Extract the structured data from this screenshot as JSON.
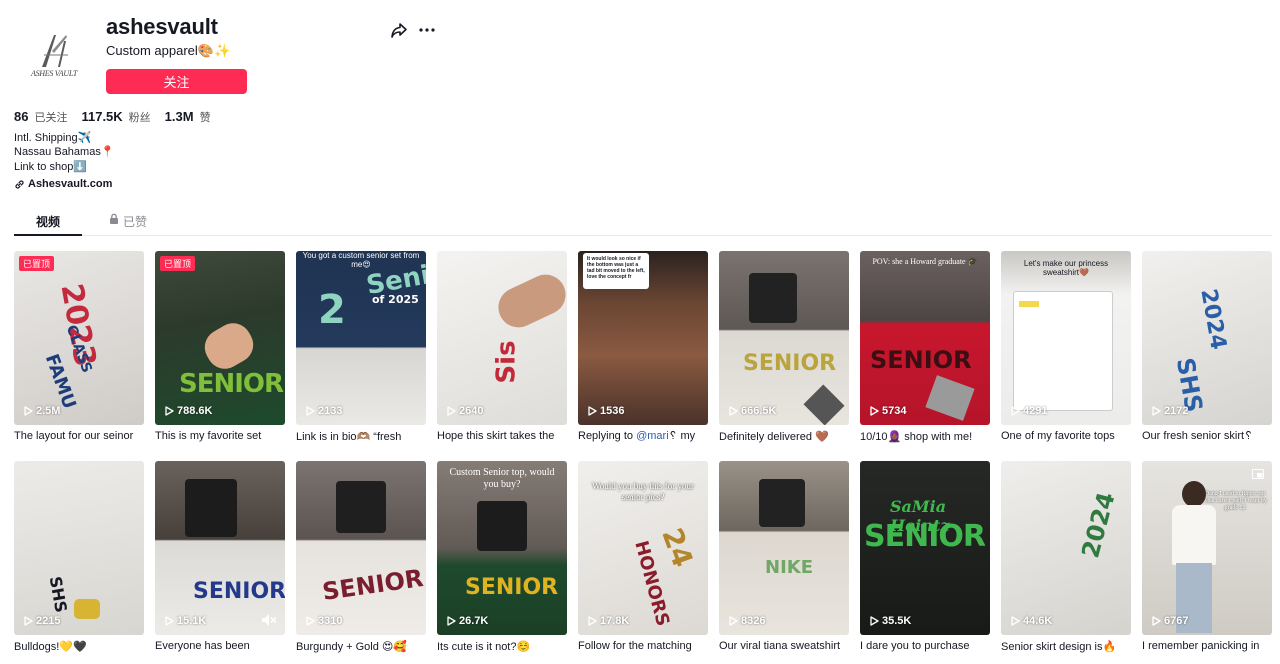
{
  "profile": {
    "username": "ashesvault",
    "nickname": "Custom apparel🎨✨",
    "follow_label": "关注",
    "logo_text": "ASHES VAULT",
    "stats": [
      {
        "value": "86",
        "label": "已关注"
      },
      {
        "value": "117.5K",
        "label": "粉丝"
      },
      {
        "value": "1.3M",
        "label": "赞"
      }
    ],
    "bio": [
      "Intl. Shipping✈️",
      "Nassau Bahamas📍",
      "Link to shop⬇️"
    ],
    "link": "Ashesvault.com"
  },
  "tabs": [
    {
      "label": "视频"
    },
    {
      "label": "已赞"
    }
  ],
  "colors": {
    "accent": "#fe2c55",
    "text": "#161823",
    "muted": "#8a8b91"
  },
  "videos": [
    {
      "views": "2.5M",
      "caption": "The layout for our seinor",
      "pinned": "已置顶"
    },
    {
      "views": "788.6K",
      "caption": "This is my favorite set",
      "pinned": "已置顶"
    },
    {
      "views": "2133",
      "caption": "Link is in bio🫶🏽 “fresh",
      "overlay": "You got a custom senior set from me😍"
    },
    {
      "views": "2640",
      "caption": "Hope this skirt takes the"
    },
    {
      "views": "1536",
      "caption_pre": "Replying to ",
      "mention": "@mari",
      "caption_post": "␦ my",
      "overlay": "It would look so nice if the bottom was just a tad bit moved to the left, love the concept fr"
    },
    {
      "views": "666.5K",
      "caption": "Definitely delivered 🤎"
    },
    {
      "views": "5734",
      "caption": "10/10🧕🏾 shop with me!",
      "overlay": "POV: she a Howard graduate 🎓"
    },
    {
      "views": "4291",
      "caption": "One of my favorite tops",
      "overlay": "Let's make our princess sweatshirt🤎"
    },
    {
      "views": "2172",
      "caption": "Our fresh senior skirt␦"
    },
    {
      "views": "2215",
      "caption": "Bulldogs!💛🖤"
    },
    {
      "views": "15.1K",
      "caption": "Everyone has been"
    },
    {
      "views": "3310",
      "caption": "Burgundy + Gold 😍🥰"
    },
    {
      "views": "26.7K",
      "caption": "Its cute is it not?☺️",
      "overlay": "Custom Senior top, would you buy?"
    },
    {
      "views": "17.8K",
      "caption": "Follow for the matching",
      "overlay": "Would you buy this for your senior pics?"
    },
    {
      "views": "8326",
      "caption": "Our viral tiana sweatshirt"
    },
    {
      "views": "35.5K",
      "caption": "I dare you to purchase"
    },
    {
      "views": "44.6K",
      "caption": "Senior skirt design is🔥"
    },
    {
      "views": "6767",
      "caption": "I remember panicking in",
      "overlay": "Dang I used to figure out what career path I want by grade 12"
    }
  ]
}
